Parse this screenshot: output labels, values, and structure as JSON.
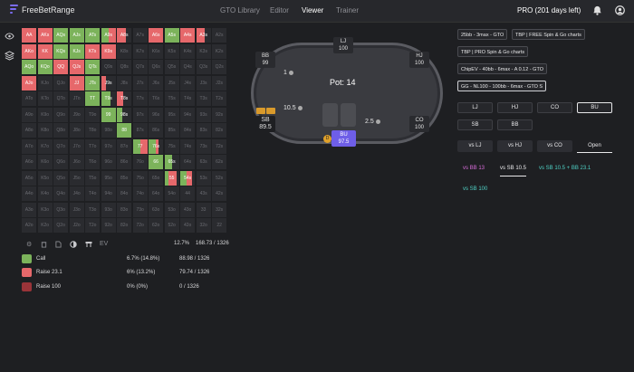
{
  "app": {
    "name": "FreeBetRange",
    "nav": [
      "GTO Library",
      "Editor",
      "Viewer",
      "Trainer"
    ],
    "active_nav": "Viewer",
    "plan": "PRO (201 days left)",
    "icons": [
      "bell-icon",
      "user-icon"
    ]
  },
  "colors": {
    "call": "#7cb35b",
    "raise": "#e6686b",
    "allin": "#9a3439",
    "accent": "#7b6cf5"
  },
  "ranks": [
    "A",
    "K",
    "Q",
    "J",
    "T",
    "9",
    "8",
    "7",
    "6",
    "5",
    "4",
    "3",
    "2"
  ],
  "hands": {
    "AA": {
      "call": 0,
      "raise": 1,
      "allin": 0
    },
    "AKs": {
      "call": 0,
      "raise": 1,
      "allin": 0
    },
    "AQs": {
      "call": 1,
      "raise": 0,
      "allin": 0
    },
    "AJs": {
      "call": 1,
      "raise": 0,
      "allin": 0
    },
    "ATs": {
      "call": 1,
      "raise": 0,
      "allin": 0
    },
    "A9s": {
      "call": 0.5,
      "raise": 0.5,
      "allin": 0
    },
    "A8s": {
      "call": 0,
      "raise": 0.6,
      "allin": 0
    },
    "A6s": {
      "call": 0,
      "raise": 1,
      "allin": 0
    },
    "A5s": {
      "call": 1,
      "raise": 0,
      "allin": 0
    },
    "A4s": {
      "call": 0,
      "raise": 1,
      "allin": 0
    },
    "A3s": {
      "call": 0,
      "raise": 0.6,
      "allin": 0
    },
    "AKo": {
      "call": 0,
      "raise": 1,
      "allin": 0
    },
    "KK": {
      "call": 0,
      "raise": 1,
      "allin": 0
    },
    "KQs": {
      "call": 1,
      "raise": 0,
      "allin": 0
    },
    "KJs": {
      "call": 1,
      "raise": 0,
      "allin": 0
    },
    "KTs": {
      "call": 0,
      "raise": 1,
      "allin": 0
    },
    "K9s": {
      "call": 0,
      "raise": 1,
      "allin": 0
    },
    "AQo": {
      "call": 1,
      "raise": 0,
      "allin": 0
    },
    "KQo": {
      "call": 1,
      "raise": 0,
      "allin": 0
    },
    "QQ": {
      "call": 0,
      "raise": 1,
      "allin": 0
    },
    "QJs": {
      "call": 0,
      "raise": 1,
      "allin": 0
    },
    "QTs": {
      "call": 1,
      "raise": 0,
      "allin": 0
    },
    "AJo": {
      "call": 0,
      "raise": 1,
      "allin": 0
    },
    "JJ": {
      "call": 0,
      "raise": 1,
      "allin": 0
    },
    "JTs": {
      "call": 1,
      "raise": 0,
      "allin": 0
    },
    "J9s": {
      "call": 0,
      "raise": 0.35,
      "allin": 0
    },
    "TT": {
      "call": 1,
      "raise": 0,
      "allin": 0
    },
    "T9s": {
      "call": 0.65,
      "raise": 0,
      "allin": 0
    },
    "T8s": {
      "call": 0,
      "raise": 0.45,
      "allin": 0
    },
    "99": {
      "call": 1,
      "raise": 0,
      "allin": 0
    },
    "98s": {
      "call": 0.35,
      "raise": 0,
      "allin": 0
    },
    "88": {
      "call": 1,
      "raise": 0,
      "allin": 0
    },
    "77": {
      "call": 0.5,
      "raise": 0.5,
      "allin": 0
    },
    "76s": {
      "call": 0.5,
      "raise": 0.2,
      "allin": 0
    },
    "66": {
      "call": 1,
      "raise": 0,
      "allin": 0
    },
    "65s": {
      "call": 0.5,
      "raise": 0,
      "allin": 0
    },
    "55": {
      "call": 0.3,
      "raise": 0.5,
      "allin": 0
    },
    "54s": {
      "call": 0.4,
      "raise": 0.4,
      "allin": 0
    }
  },
  "grid_footer": {
    "icons": [
      "gear-icon",
      "bucket-icon",
      "file-icon",
      "contrast-icon",
      "table-icon"
    ],
    "ev_label": "EV",
    "total_pct": "12.7%",
    "total_combos": "168.73 / 1326"
  },
  "legend": [
    {
      "label": "Call",
      "pct": "6.7% (14.8%)",
      "combos": "88.98 / 1326",
      "color": "#7cb35b"
    },
    {
      "label": "Raise 23.1",
      "pct": "6% (13.2%)",
      "combos": "79.74 / 1326",
      "color": "#e6686b"
    },
    {
      "label": "Raise 100",
      "pct": "0% (0%)",
      "combos": "0 / 1326",
      "color": "#9a3439"
    }
  ],
  "table": {
    "pot_label": "Pot: 14",
    "seats": {
      "lj": {
        "name": "LJ",
        "stack": "100"
      },
      "hj": {
        "name": "HJ",
        "stack": "100"
      },
      "co": {
        "name": "CO",
        "stack": "100"
      },
      "bu": {
        "name": "BU",
        "stack": "97.5"
      },
      "sb": {
        "name": "SB",
        "stack": "89.5"
      },
      "bb": {
        "name": "BB",
        "stack": "99"
      }
    },
    "bets": {
      "bb": "1",
      "sb": "10.5",
      "bu": "2.5"
    },
    "dealer": "D"
  },
  "presets": [
    "25bb - 3max - GTO",
    "TBP | FREE Spin & Go charts",
    "TBP | PRO Spin & Go charts",
    "ChipEV - 40bb - 6max - A 0.12 - GTO",
    "GG - NL100 - 100bb - 6max - GTO S"
  ],
  "positions": [
    "LJ",
    "HJ",
    "CO",
    "BU",
    "SB",
    "BB"
  ],
  "active_position": "BU",
  "vs_tabs": [
    "vs LJ",
    "vs HJ",
    "vs CO",
    "Open"
  ],
  "line_tabs": [
    {
      "label": "vs BB 13",
      "color": "#d66bd8"
    },
    {
      "label": "vs SB 10.5",
      "color": "#e8e8ea"
    },
    {
      "label": "vs SB 10.5 + BB 23.1",
      "color": "#4fd1c5"
    },
    {
      "label": "vs SB 100",
      "color": "#4fd1c5"
    }
  ]
}
